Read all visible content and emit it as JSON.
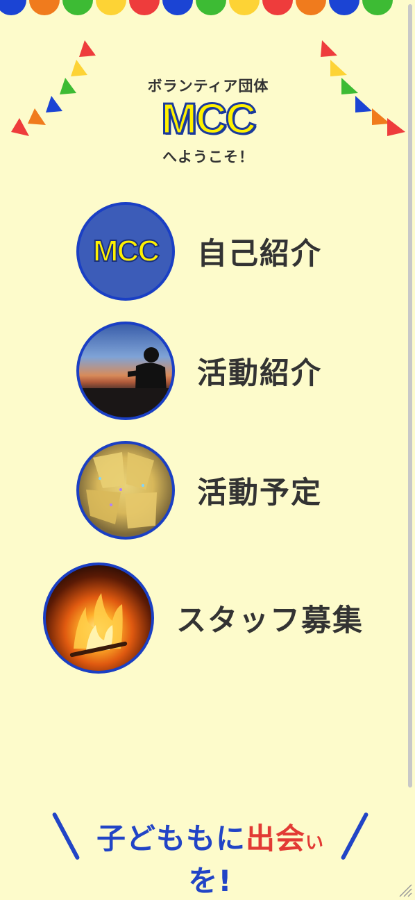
{
  "hero": {
    "subtitle": "ボランティア団体",
    "logo": "MCC",
    "welcome": "へようこそ！"
  },
  "menu": {
    "items": [
      {
        "label": "自己紹介",
        "thumb_logo": "MCC"
      },
      {
        "label": "活動紹介"
      },
      {
        "label": "活動予定"
      },
      {
        "label": "スタッフ募集"
      }
    ]
  },
  "footer": {
    "slogan_1": "子ども",
    "slogan_2": "も",
    "slogan_3": "に",
    "slogan_4": "出会",
    "slogan_5": "い",
    "slogan_6": "を",
    "slogan_7": "!"
  },
  "colors": {
    "background": "#fdfbcb",
    "accent_blue": "#1a3fc4",
    "logo_yellow": "#fff100",
    "slogan_red": "#e23a34"
  }
}
